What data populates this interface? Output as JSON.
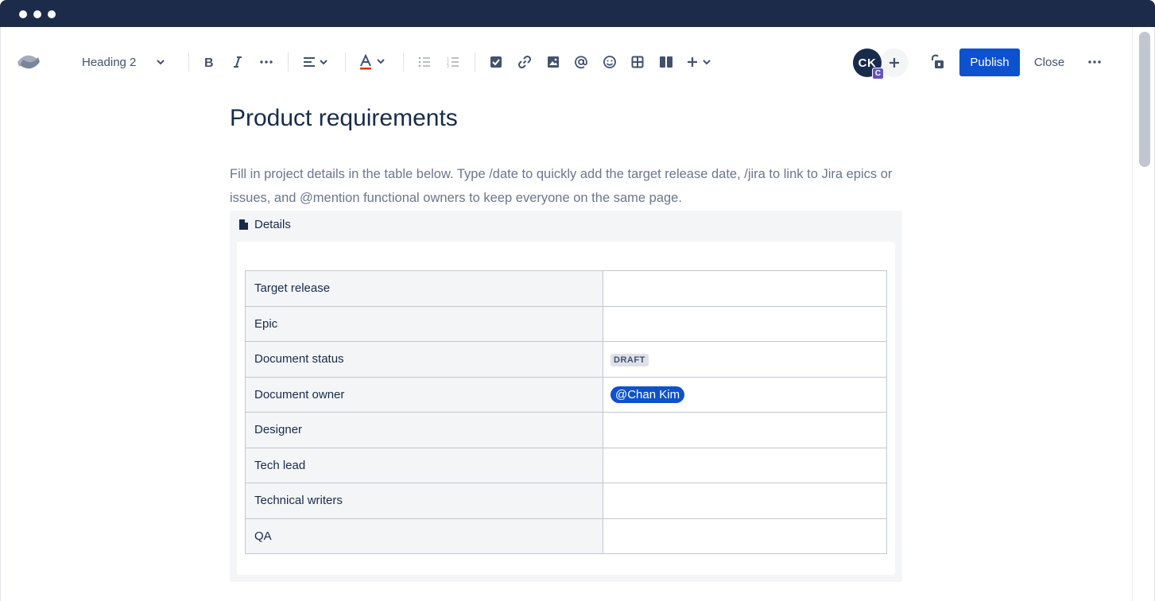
{
  "window": {
    "dots": [
      "close",
      "minimize",
      "maximize"
    ]
  },
  "toolbar": {
    "logo_icon": "confluence-logo",
    "text_style": "Heading 2",
    "bold_icon": "bold-icon",
    "italic_icon": "italic-icon",
    "more_formatting_icon": "more-icon",
    "align_icon": "align-left-icon",
    "text_color_icon": "text-color-icon",
    "bullet_list_icon": "bullet-list-icon",
    "numbered_list_icon": "numbered-list-icon",
    "action_item_icon": "checkbox-icon",
    "link_icon": "link-icon",
    "image_icon": "image-icon",
    "mention_icon": "at-icon",
    "emoji_icon": "emoji-icon",
    "table_icon": "table-icon",
    "layouts_icon": "layout-icon",
    "insert_icon": "plus-icon"
  },
  "collaborators": {
    "avatar_initials": "CK",
    "avatar_badge": "C",
    "invite_icon": "plus-icon"
  },
  "actions": {
    "restrictions_icon": "unlock-icon",
    "publish_label": "Publish",
    "close_label": "Close",
    "more_icon": "more-icon"
  },
  "page": {
    "title": "Product requirements",
    "intro": "Fill in project details in the table below. Type /date to quickly add the target release date, /jira to link to Jira epics or issues, and @mention functional owners to keep everyone on the same page."
  },
  "details_panel": {
    "title": "Details",
    "icon": "document-icon",
    "rows": [
      {
        "key": "Target release",
        "value": ""
      },
      {
        "key": "Epic",
        "value": ""
      },
      {
        "key": "Document status",
        "value": "DRAFT",
        "type": "status"
      },
      {
        "key": "Document owner",
        "value": "@Chan Kim",
        "type": "mention"
      },
      {
        "key": "Designer",
        "value": ""
      },
      {
        "key": "Tech lead",
        "value": ""
      },
      {
        "key": "Technical writers",
        "value": ""
      },
      {
        "key": "QA",
        "value": ""
      }
    ]
  },
  "colors": {
    "titlebar": "#1c2b4a",
    "primary": "#0c52cc",
    "text": "#172b4d",
    "subtle_text": "#6b778c",
    "panel_bg": "#f4f5f7",
    "avatar_badge": "#6554c0"
  }
}
